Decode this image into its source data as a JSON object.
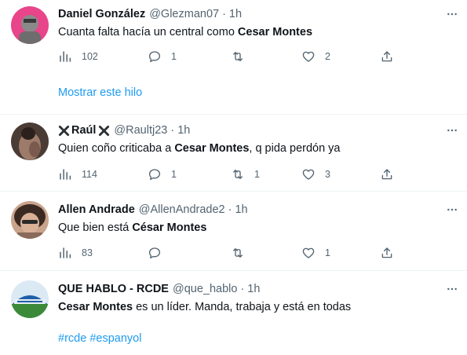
{
  "tweets": [
    {
      "name": "Daniel González",
      "handle": "@Glezman07",
      "time": "1h",
      "text_pre": "Cuanta falta hacía un central como ",
      "text_bold": "Cesar Montes",
      "text_post": "",
      "views": "102",
      "replies": "1",
      "retweets": "",
      "likes": "2"
    },
    {
      "name": "Raúl",
      "handle": "@Raultj23",
      "time": "1h",
      "text_pre": "Quien coño criticaba a ",
      "text_bold": "Cesar Montes",
      "text_post": ", q pida perdón ya",
      "views": "114",
      "replies": "1",
      "retweets": "1",
      "likes": "3"
    },
    {
      "name": "Allen Andrade",
      "handle": "@AllenAndrade2",
      "time": "1h",
      "text_pre": "Que bien está ",
      "text_bold": "César Montes",
      "text_post": "",
      "views": "83",
      "replies": "",
      "retweets": "",
      "likes": "1"
    },
    {
      "name": "QUE HABLO - RCDE",
      "handle": "@que_hablo",
      "time": "1h",
      "text_pre": "",
      "text_bold": "Cesar Montes",
      "text_post": " es un líder. Manda, trabaja y está en todas",
      "hashtags": [
        "#rcde",
        "#espanyol"
      ]
    }
  ],
  "show_thread_label": "Mostrar este hilo",
  "separator_dot": "·",
  "colors": {
    "accent": "#1d9bf0",
    "secondary_text": "#536471",
    "divider": "#eff3f4"
  },
  "icons": {
    "more": "more-dots-icon",
    "views": "views-chart-icon",
    "reply": "reply-bubble-icon",
    "retweet": "retweet-icon",
    "like": "heart-icon",
    "share": "share-upload-icon",
    "name_decoration": "cross-x-icon"
  }
}
